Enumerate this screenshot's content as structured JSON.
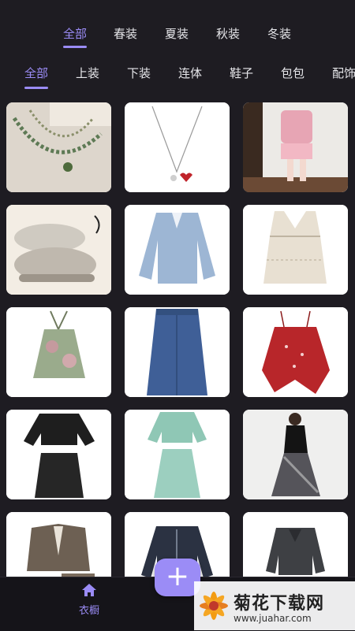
{
  "season_tabs": [
    "全部",
    "春装",
    "夏装",
    "秋装",
    "冬装"
  ],
  "category_tabs": [
    "全部",
    "上装",
    "下装",
    "连体",
    "鞋子",
    "包包",
    "配饰"
  ],
  "items": [
    {
      "name": "bead-necklace"
    },
    {
      "name": "heart-pendant-necklace"
    },
    {
      "name": "pink-cardigan-skirt-outfit"
    },
    {
      "name": "chunky-sneakers"
    },
    {
      "name": "denim-shirt"
    },
    {
      "name": "crochet-vest"
    },
    {
      "name": "halter-top"
    },
    {
      "name": "denim-skirt"
    },
    {
      "name": "red-floral-camisole"
    },
    {
      "name": "black-knit-set"
    },
    {
      "name": "mint-knit-set"
    },
    {
      "name": "black-dress-outfit"
    },
    {
      "name": "tweed-jacket-set"
    },
    {
      "name": "navy-cardigan"
    },
    {
      "name": "gray-bow-blouse-set"
    }
  ],
  "bottom_nav": {
    "wardrobe_label": "衣橱",
    "add_label": "+"
  },
  "watermark": {
    "title": "菊花下载网",
    "url": "www.juahar.com"
  },
  "colors": {
    "accent": "#9b8cf6",
    "background": "#1e1c22"
  }
}
